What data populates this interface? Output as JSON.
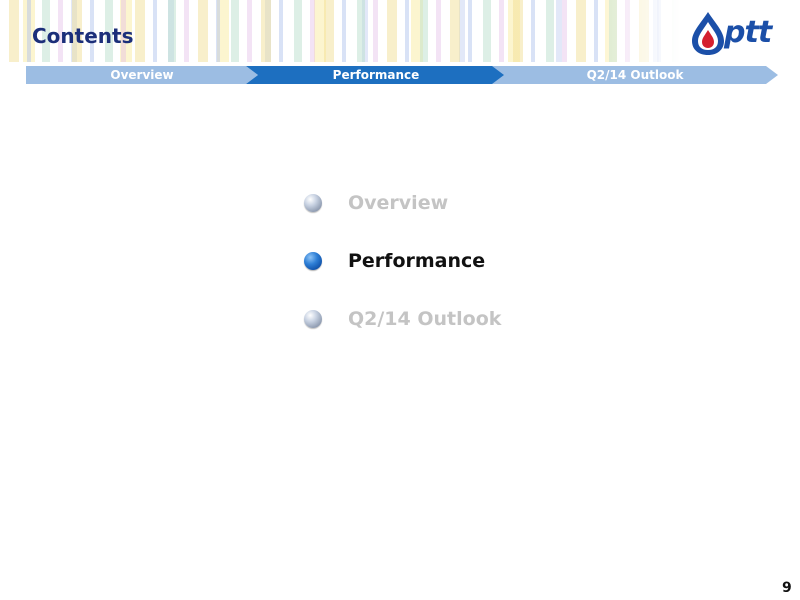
{
  "header": {
    "title": "Contents",
    "logo_text": "ptt",
    "logo_icon": "ptt-flame-drop-logo",
    "colors": {
      "title": "#1c2f7a",
      "logo_blue": "#1b4fa8",
      "logo_red": "#d4202f"
    }
  },
  "nav": {
    "segments": [
      {
        "label": "Overview",
        "active": false
      },
      {
        "label": "Performance",
        "active": true
      },
      {
        "label": "Q2/14 Outlook",
        "active": false
      }
    ],
    "colors": {
      "active": "#1d6fc0",
      "inactive": "#9cbde3"
    }
  },
  "contents": {
    "items": [
      {
        "label": "Overview",
        "active": false
      },
      {
        "label": "Performance",
        "active": true
      },
      {
        "label": "Q2/14 Outlook",
        "active": false
      }
    ],
    "colors": {
      "active_text": "#111111",
      "inactive_text": "#c4c4c4"
    }
  },
  "footer": {
    "page_number": "9"
  }
}
